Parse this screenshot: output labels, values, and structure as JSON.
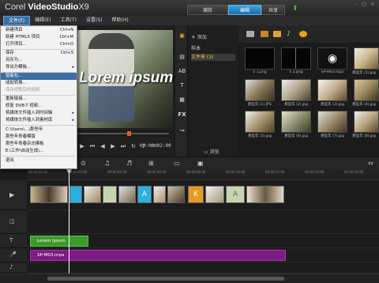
{
  "app": {
    "title_prefix": "Corel",
    "title_main": "VideoStudio",
    "title_version": "X9"
  },
  "steps": [
    {
      "label": "捕获"
    },
    {
      "label": "编辑"
    },
    {
      "label": "共享"
    }
  ],
  "menubar": [
    {
      "label": "文件(F)"
    },
    {
      "label": "编辑(E)"
    },
    {
      "label": "工具(T)"
    },
    {
      "label": "设置(S)"
    },
    {
      "label": "帮助(H)"
    }
  ],
  "file_menu": [
    {
      "label": "新建项目",
      "shortcut": "Ctrl+N"
    },
    {
      "label": "新建 HTML5 项目",
      "shortcut": "Ctrl+M"
    },
    {
      "label": "打开项目...",
      "shortcut": "Ctrl+O"
    },
    {
      "label": "保存",
      "shortcut": "Ctrl+S"
    },
    {
      "label": "另存为..."
    },
    {
      "label": "导出为模板...",
      "arrow": "▸"
    },
    {
      "label": "智能包..."
    },
    {
      "label": "成批转换..."
    },
    {
      "label": "保存修整后的视频"
    },
    {
      "label": "重新链接..."
    },
    {
      "label": "修复 DVB-T 视频..."
    },
    {
      "label": "将媒体文件插入到时间轴",
      "arrow": "▸"
    },
    {
      "label": "将媒体文件插入到素材库",
      "arrow": "▸"
    },
    {
      "label": "C:\\Users\\...\\那些年"
    },
    {
      "label": "那些年青春模版"
    },
    {
      "label": "那些年青春杂志模板"
    },
    {
      "label": "E:\\工作\\自动生成\\..."
    },
    {
      "label": "退出"
    }
  ],
  "preview": {
    "overlay_text": "Lorem ipsum",
    "timecode": "00:00:02:00"
  },
  "library": {
    "add_label": "添加",
    "folders": [
      {
        "label": "样本"
      },
      {
        "label": "文件夹 (3)"
      }
    ],
    "browse_label": "浏览",
    "thumbs": [
      {
        "label": "S 1.png"
      },
      {
        "label": "S 2.png"
      },
      {
        "label": "SP-M03.mpa"
      },
      {
        "label": "那些年 (1).jpg"
      },
      {
        "label": "那些年 (1).JPG"
      },
      {
        "label": "那些年 (2).jpg"
      },
      {
        "label": "那些年 (3).jpg"
      },
      {
        "label": "那些年 (4).jpg"
      },
      {
        "label": "那些年 (5).jpg"
      },
      {
        "label": "那些年 (6).jpg"
      },
      {
        "label": "那些年 (7).jpg"
      },
      {
        "label": "那些年 (8).jpg"
      }
    ]
  },
  "timeline": {
    "ruler": [
      "00:00:00:00",
      "00:00:02:00",
      "00:00:04:00",
      "00:00:06:00",
      "00:00:08:00",
      "00:00:10:00",
      "00:00:12:00",
      "00:00:14:00",
      "00:00:16:00"
    ],
    "title_clip": "Lorem ipsum",
    "music_clip": "SP-M03.mpa"
  },
  "colors": {
    "accent_tab": "#2a8fd0",
    "title_clip": "#3c9a2a",
    "music_clip": "#7d1a84"
  }
}
